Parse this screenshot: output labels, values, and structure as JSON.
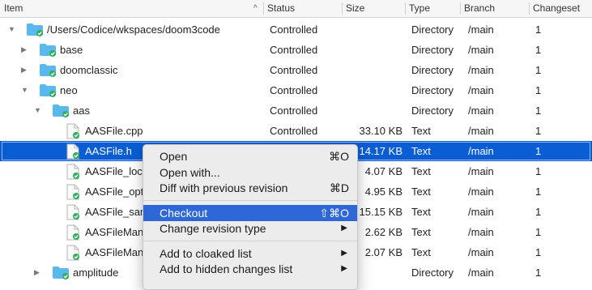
{
  "columns": {
    "item": "Item",
    "status": "Status",
    "size": "Size",
    "type": "Type",
    "branch": "Branch",
    "changeset": "Changeset"
  },
  "sort_indicator": "^",
  "rows": [
    {
      "name": "/Users/Codice/wkspaces/doom3code",
      "status": "Controlled",
      "size": "",
      "type": "Directory",
      "branch": "/main",
      "changeset": "1"
    },
    {
      "name": "base",
      "status": "Controlled",
      "size": "",
      "type": "Directory",
      "branch": "/main",
      "changeset": "1"
    },
    {
      "name": "doomclassic",
      "status": "Controlled",
      "size": "",
      "type": "Directory",
      "branch": "/main",
      "changeset": "1"
    },
    {
      "name": "neo",
      "status": "Controlled",
      "size": "",
      "type": "Directory",
      "branch": "/main",
      "changeset": "1"
    },
    {
      "name": "aas",
      "status": "Controlled",
      "size": "",
      "type": "Directory",
      "branch": "/main",
      "changeset": "1"
    },
    {
      "name": "AASFile.cpp",
      "status": "Controlled",
      "size": "33.10 KB",
      "type": "Text",
      "branch": "/main",
      "changeset": "1"
    },
    {
      "name": "AASFile.h",
      "status": "",
      "size": "14.17 KB",
      "type": "Text",
      "branch": "/main",
      "changeset": "1"
    },
    {
      "name": "AASFile_loca",
      "status": "",
      "size": "4.07 KB",
      "type": "Text",
      "branch": "/main",
      "changeset": "1"
    },
    {
      "name": "AASFile_opti",
      "status": "",
      "size": "4.95 KB",
      "type": "Text",
      "branch": "/main",
      "changeset": "1"
    },
    {
      "name": "AASFile_sam",
      "status": "",
      "size": "15.15 KB",
      "type": "Text",
      "branch": "/main",
      "changeset": "1"
    },
    {
      "name": "AASFileMana",
      "status": "",
      "size": "2.62 KB",
      "type": "Text",
      "branch": "/main",
      "changeset": "1"
    },
    {
      "name": "AASFileMana",
      "status": "",
      "size": "2.07 KB",
      "type": "Text",
      "branch": "/main",
      "changeset": "1"
    },
    {
      "name": "amplitude",
      "status": "",
      "size": "",
      "type": "Directory",
      "branch": "/main",
      "changeset": "1"
    }
  ],
  "context_menu": {
    "open": {
      "label": "Open",
      "shortcut": "⌘O"
    },
    "open_with": {
      "label": "Open with..."
    },
    "diff": {
      "label": "Diff with previous revision",
      "shortcut": "⌘D"
    },
    "checkout": {
      "label": "Checkout",
      "shortcut": "⇧⌘O"
    },
    "change_type": {
      "label": "Change revision type"
    },
    "cloaked": {
      "label": "Add to cloaked list"
    },
    "hidden": {
      "label": "Add to hidden changes list"
    }
  },
  "colors": {
    "selection": "#0a5dd3",
    "menu_highlight": "#2e67d8",
    "folder": "#5bb8ec",
    "check_badge": "#2fae5d"
  }
}
